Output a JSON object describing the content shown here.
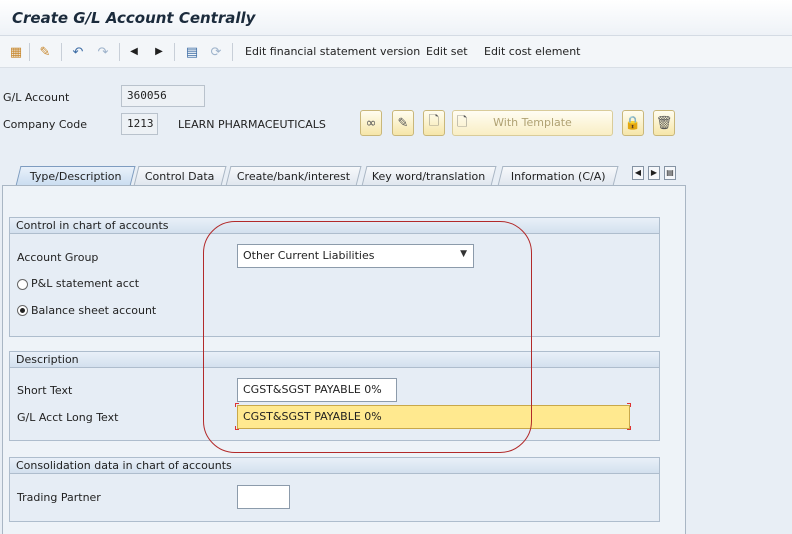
{
  "window": {
    "title": "Create G/L Account Centrally"
  },
  "toolbar": {
    "edit_fs_version": "Edit financial statement version",
    "edit_set": "Edit set",
    "edit_cost_element": "Edit cost element",
    "icons": [
      "overview-icon",
      "change-icon",
      "undo-icon",
      "redo-icon",
      "previous-icon",
      "next-icon",
      "document-icon",
      "refresh-icon"
    ]
  },
  "header": {
    "gl_account_label": "G/L Account",
    "gl_account_value": "360056",
    "company_code_label": "Company Code",
    "company_code_value": "1213",
    "company_name": "LEARN PHARMACEUTICALS",
    "with_template_label": "With Template"
  },
  "tabs": [
    {
      "label": "Type/Description",
      "active": true
    },
    {
      "label": "Control Data",
      "active": false
    },
    {
      "label": "Create/bank/interest",
      "active": false
    },
    {
      "label": "Key word/translation",
      "active": false
    },
    {
      "label": "Information (C/A)",
      "active": false
    }
  ],
  "control": {
    "title": "Control in chart of accounts",
    "account_group_label": "Account Group",
    "account_group_value": "Other Current Liabilities",
    "pl_label": "P&L statement acct",
    "bs_label": "Balance sheet account",
    "selected": "Balance sheet account"
  },
  "description": {
    "title": "Description",
    "short_text_label": "Short Text",
    "short_text_value": "CGST&SGST PAYABLE 0%",
    "long_text_label": "G/L Acct Long Text",
    "long_text_value": "CGST&SGST PAYABLE 0%"
  },
  "consolidation": {
    "title": "Consolidation data in chart of accounts",
    "trading_partner_label": "Trading Partner",
    "trading_partner_value": ""
  },
  "colors": {
    "highlight": "#b22a2a",
    "required_field": "#ffe98f",
    "panel": "#eef3f8"
  }
}
